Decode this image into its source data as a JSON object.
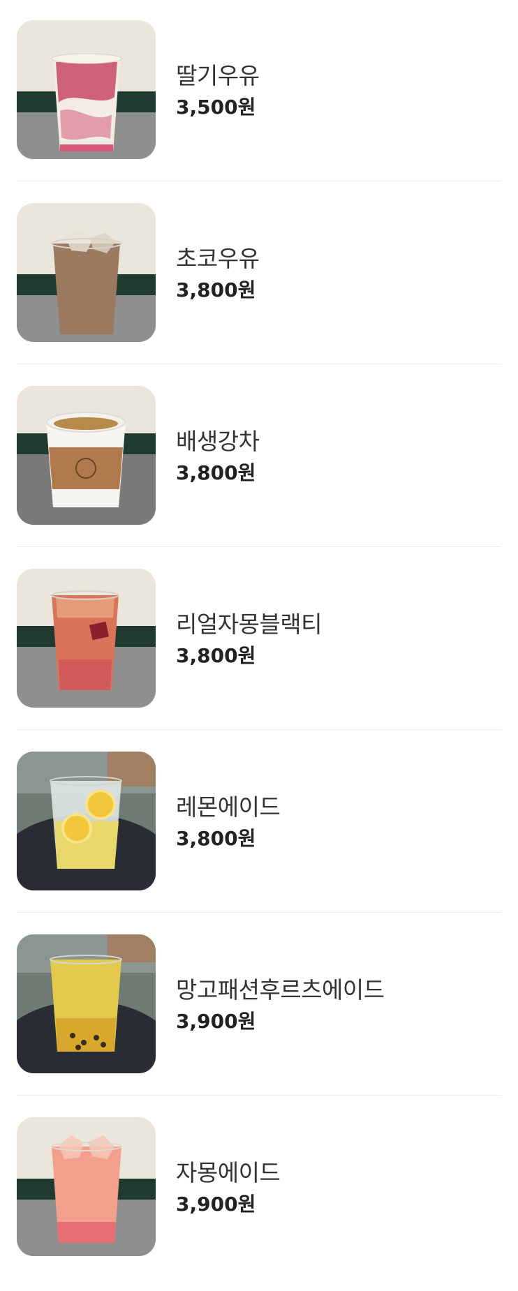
{
  "menu": {
    "items": [
      {
        "name": "딸기우유",
        "price": "3,500원",
        "image": "strawberry-milk-photo"
      },
      {
        "name": "초코우유",
        "price": "3,800원",
        "image": "chocolate-milk-photo"
      },
      {
        "name": "배생강차",
        "price": "3,800원",
        "image": "pear-ginger-tea-photo"
      },
      {
        "name": "리얼자몽블랙티",
        "price": "3,800원",
        "image": "grapefruit-black-tea-photo"
      },
      {
        "name": "레몬에이드",
        "price": "3,800원",
        "image": "lemonade-photo"
      },
      {
        "name": "망고패션후르츠에이드",
        "price": "3,900원",
        "image": "mango-passionfruit-ade-photo"
      },
      {
        "name": "자몽에이드",
        "price": "3,900원",
        "image": "grapefruit-ade-photo"
      }
    ]
  }
}
